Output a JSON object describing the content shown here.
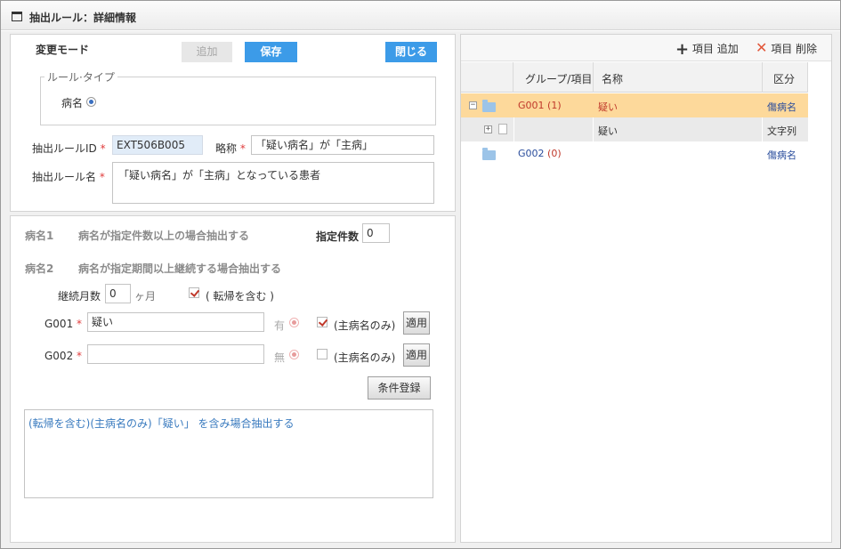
{
  "window": {
    "title": "抽出ルール：詳細情報"
  },
  "form": {
    "mode_label": "変更モード",
    "add_button": "追加",
    "save_button": "保存",
    "close_button": "閉じる",
    "rule_type_legend": "ルール·タイプ",
    "rule_type_option": "病名",
    "rule_id_label": "抽出ルールID",
    "rule_id_value": "EXT506B005",
    "abbr_label": "略称",
    "abbr_value": "「疑い病名」が「主病」",
    "rule_name_label": "抽出ルール名",
    "rule_name_value": "「疑い病名」が「主病」となっている患者"
  },
  "conditions": {
    "cond1_num": "病名1",
    "cond1_text": "病名が指定件数以上の場合抽出する",
    "count_label": "指定件数",
    "count_value": "0",
    "cond2_num": "病名2",
    "cond2_text": "病名が指定期間以上継続する場合抽出する",
    "months_label": "継続月数",
    "months_value": "0",
    "months_unit": "ヶ月",
    "transfer_label": "( 転帰を含む )",
    "rows": [
      {
        "id": "G001",
        "value": "疑い",
        "flag": "有",
        "main_label": "(主病名のみ)",
        "main_checked": true,
        "apply": "適用"
      },
      {
        "id": "G002",
        "value": "",
        "flag": "無",
        "main_label": "(主病名のみ)",
        "main_checked": false,
        "apply": "適用"
      }
    ],
    "register_button": "条件登録",
    "summary": "(転帰を含む)(主病名のみ)「疑い」 を含み場合抽出する"
  },
  "right": {
    "add_item": "項目 追加",
    "delete_item": "項目 削除",
    "columns": [
      "グループ/項目",
      "名称",
      "区分"
    ],
    "rows": [
      {
        "group": "G001",
        "count": "(1)",
        "name": "疑い",
        "kind": "傷病名"
      },
      {
        "group": "",
        "count": "",
        "name": "疑い",
        "kind": "文字列"
      },
      {
        "group": "G002",
        "count": "(0)",
        "name": "",
        "kind": "傷病名"
      }
    ]
  },
  "colors": {
    "accent": "#3c9be8",
    "selected_row": "#fdd99b",
    "required": "#e03c3c",
    "group_link": "#c0392b",
    "kind_link": "#2a4d9c"
  }
}
